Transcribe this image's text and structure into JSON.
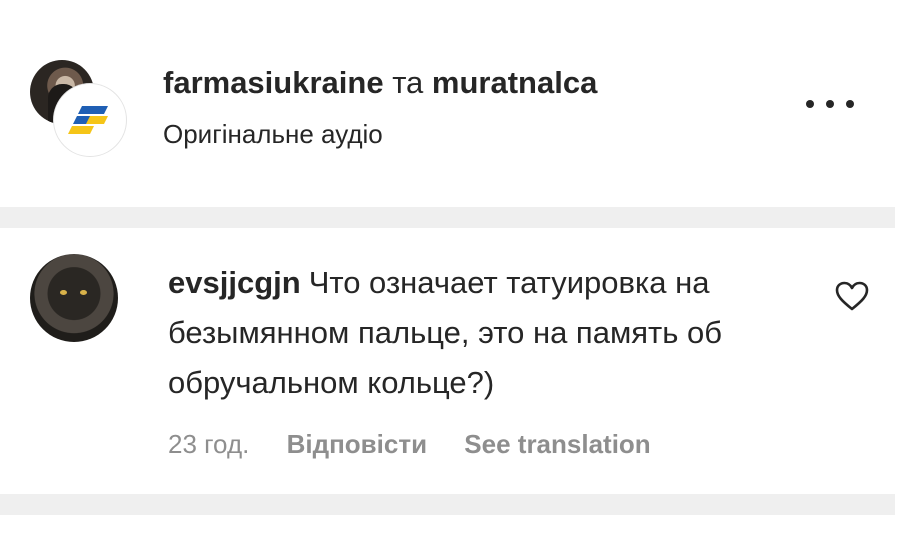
{
  "post": {
    "user1": "farmasiukraine",
    "conjunction": "та",
    "user2": "muratnalca",
    "audio": "Оригінальне аудіо",
    "icons": {
      "more": "more-horizontal-icon",
      "brand": "farmasi-logo-icon"
    },
    "colors": {
      "brand_blue": "#1f5fb4",
      "brand_yellow": "#f5c518"
    }
  },
  "comment": {
    "username": "evsjjcgjn",
    "text": "Что означает татуировка на безымянном пальце, это на память об обручальном кольце?)",
    "time": "23 год.",
    "reply": "Відповісти",
    "translate": "See translation",
    "icons": {
      "like": "heart-outline-icon"
    }
  },
  "colors": {
    "text": "#262626",
    "secondary": "#8e8e8e",
    "separator": "#efefef"
  }
}
